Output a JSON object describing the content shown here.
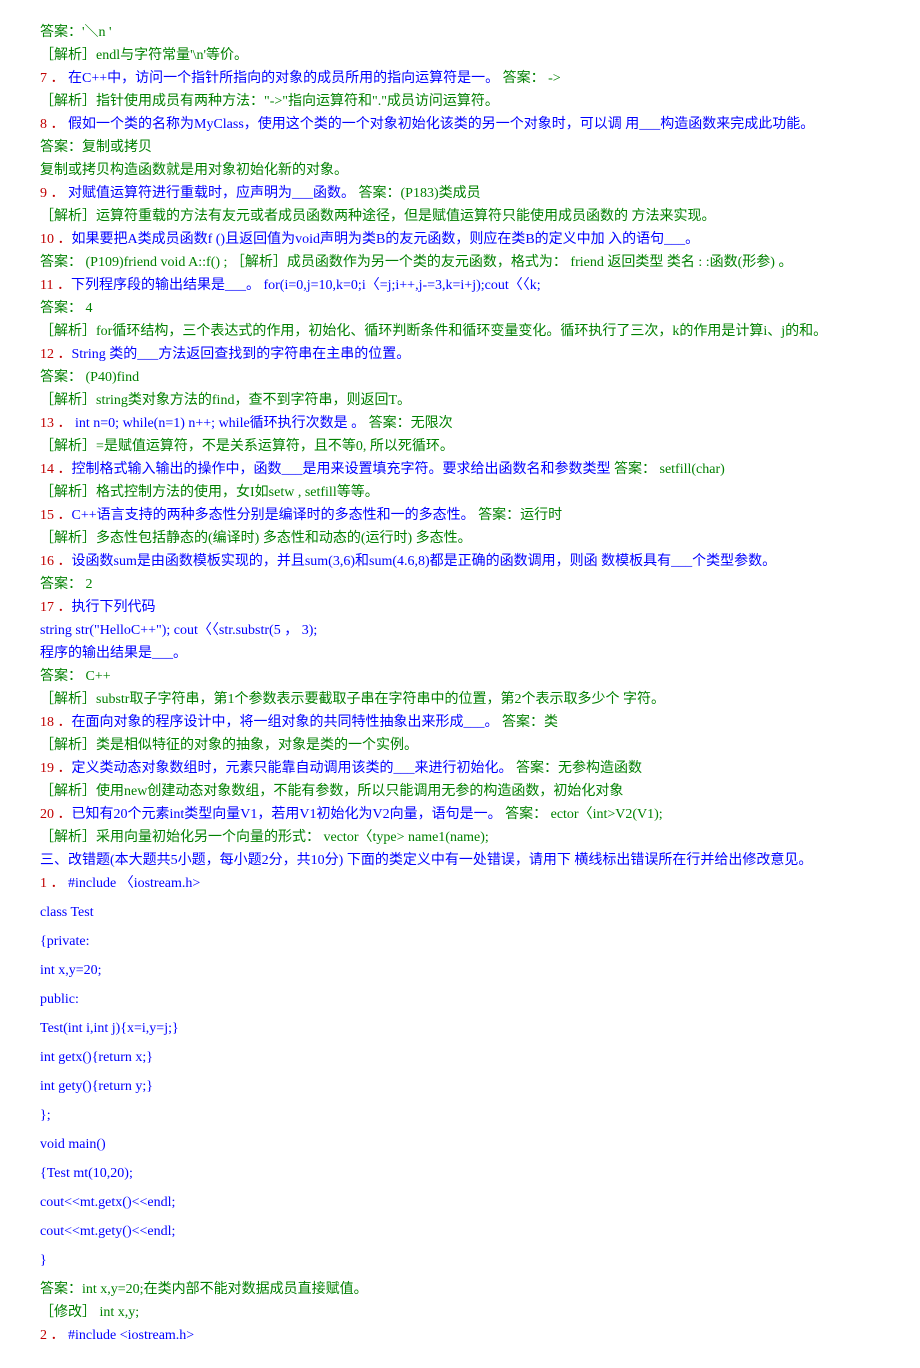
{
  "lines": [
    {
      "cls": "green",
      "t": "答案：'＼n '"
    },
    {
      "cls": "green",
      "t": "［解析］endl与字符常量'\\n'等价。"
    },
    {
      "parts": [
        {
          "cls": "red",
          "t": "7 ．"
        },
        {
          "cls": "blue",
          "t": "  在C++中，访问一个指针所指向的对象的成员所用的指向运算符是一。"
        },
        {
          "cls": "green",
          "t": "  答案： ->"
        }
      ]
    },
    {
      "cls": "green",
      "t": "［解析］指针使用成员有两种方法：\"->\"指向运算符和\".\"成员访问运算符。"
    },
    {
      "parts": [
        {
          "cls": "red",
          "t": "8 ．"
        },
        {
          "cls": "blue",
          "t": "  假如一个类的名称为MyClass，使用这个类的一个对象初始化该类的另一个对象时，可以调 用___构造函数来完成此功能。"
        }
      ]
    },
    {
      "cls": "green",
      "t": "答案：复制或拷贝"
    },
    {
      "cls": "green",
      "t": "复制或拷贝构造函数就是用对象初始化新的对象。"
    },
    {
      "parts": [
        {
          "cls": "red",
          "t": "9 ．"
        },
        {
          "cls": "blue",
          "t": "  对赋值运算符进行重载时，应声明为___函数。"
        },
        {
          "cls": "green",
          "t": " 答案：(P183)类成员"
        }
      ]
    },
    {
      "cls": "green",
      "t": "［解析］运算符重载的方法有友元或者成员函数两种途径，但是赋值运算符只能使用成员函数的 方法来实现。"
    },
    {
      "parts": [
        {
          "cls": "red",
          "t": "10 ．"
        },
        {
          "cls": "blue",
          "t": "如果要把A类成员函数f ()且返回值为void声明为类B的友元函数，则应在类B的定义中加 入的语句___。"
        }
      ]
    },
    {
      "cls": "green",
      "t": "答案： (P109)friend void A::f() ; ［解析］成员函数作为另一个类的友元函数，格式为： friend 返回类型  类名 : :函数(形参) 。"
    },
    {
      "parts": [
        {
          "cls": "red",
          "t": "11 ．"
        },
        {
          "cls": "blue",
          "t": "下列程序段的输出结果是___。  for(i=0,j=10,k=0;i〈=j;i++,j-=3,k=i+j);cout〈〈k;"
        }
      ]
    },
    {
      "cls": "green",
      "t": "答案： 4"
    },
    {
      "cls": "green",
      "t": "［解析］for循环结构，三个表达式的作用，初始化、循环判断条件和循环变量变化。循环执行了三次，k的作用是计算i、j的和。"
    },
    {
      "parts": [
        {
          "cls": "red",
          "t": "12 ．"
        },
        {
          "cls": "blue",
          "t": "String 类的___方法返回查找到的字符串在主串的位置。"
        }
      ]
    },
    {
      "cls": "green",
      "t": "答案： (P40)find"
    },
    {
      "cls": "green",
      "t": "［解析］string类对象方法的find，查不到字符串，则返回T。"
    },
    {
      "parts": [
        {
          "cls": "red",
          "t": "13 ．"
        },
        {
          "cls": "blue",
          "t": "  int n=0; while(n=1) n++; while循环执行次数是  。"
        },
        {
          "cls": "green",
          "t": " 答案：无限次"
        }
      ]
    },
    {
      "cls": "green",
      "t": "［解析］=是赋值运算符，不是关系运算符，且不等0, 所以死循环。"
    },
    {
      "parts": [
        {
          "cls": "red",
          "t": "14 ．"
        },
        {
          "cls": "blue",
          "t": "控制格式输入输出的操作中，函数___是用来设置填充字符。要求给出函数名和参数类型"
        },
        {
          "cls": "green",
          "t": " 答案： setfill(char)"
        }
      ]
    },
    {
      "cls": "green",
      "t": "［解析］格式控制方法的使用，女I如setw , setfill等等。"
    },
    {
      "parts": [
        {
          "cls": "red",
          "t": "15 ．"
        },
        {
          "cls": "blue",
          "t": "C++语言支持的两种多态性分别是编译时的多态性和一的多态性。"
        },
        {
          "cls": "green",
          "t": "  答案：运行时"
        }
      ]
    },
    {
      "cls": "green",
      "t": "［解析］多态性包括静态的(编译时) 多态性和动态的(运行时) 多态性。"
    },
    {
      "parts": [
        {
          "cls": "red",
          "t": "16 ．"
        },
        {
          "cls": "blue",
          "t": "设函数sum是由函数模板实现的，并且sum(3,6)和sum(4.6,8)都是正确的函数调用，则函 数模板具有___个类型参数。"
        }
      ]
    },
    {
      "cls": "green",
      "t": "答案： 2"
    },
    {
      "parts": [
        {
          "cls": "red",
          "t": "17 ．"
        },
        {
          "cls": "blue",
          "t": "执行下列代码"
        }
      ]
    },
    {
      "cls": "blue code",
      "t": "string str(\"HelloC++\"); cout〈〈str.substr(5 ， 3);"
    },
    {
      "cls": "blue",
      "t": "程序的输出结果是___。"
    },
    {
      "cls": "green",
      "t": "答案： C++"
    },
    {
      "cls": "green",
      "t": "［解析］substr取子字符串，第1个参数表示要截取子串在字符串中的位置，第2个表示取多少个 字符。"
    },
    {
      "parts": [
        {
          "cls": "red",
          "t": "18 ．"
        },
        {
          "cls": "blue",
          "t": "在面向对象的程序设计中，将一组对象的共同特性抽象出来形成___。"
        },
        {
          "cls": "green",
          "t": "  答案：类"
        }
      ]
    },
    {
      "cls": "green",
      "t": "［解析］类是相似特征的对象的抽象，对象是类的一个实例。"
    },
    {
      "parts": [
        {
          "cls": "red",
          "t": "19 ．"
        },
        {
          "cls": "blue",
          "t": "定义类动态对象数组时，元素只能靠自动调用该类的___来进行初始化。"
        },
        {
          "cls": "green",
          "t": " 答案：无参构造函数"
        }
      ]
    },
    {
      "cls": "green",
      "t": "［解析］使用new创建动态对象数组，不能有参数，所以只能调用无参的构造函数，初始化对象"
    },
    {
      "parts": [
        {
          "cls": "red",
          "t": "20 ．"
        },
        {
          "cls": "blue",
          "t": "已知有20个元素int类型向量V1，若用V1初始化为V2向量，语句是一。"
        },
        {
          "cls": "green",
          "t": "  答案： ector〈int>V2(V1);"
        }
      ]
    },
    {
      "cls": "green",
      "t": "［解析］采用向量初始化另一个向量的形式： vector〈type> name1(name);"
    },
    {
      "cls": "blue",
      "t": "三、改错题(本大题共5小题，每小题2分，共10分) 下面的类定义中有一处错误，请用下 横线标出错误所在行并给出修改意见。"
    },
    {
      "parts": [
        {
          "cls": "red",
          "t": "1 ．"
        },
        {
          "cls": "blue code",
          "t": "  #include 〈iostream.h>"
        }
      ]
    },
    {
      "cls": "blue code",
      "t": "class Test",
      "sp": true
    },
    {
      "cls": "blue code",
      "t": "{private:",
      "sp": true
    },
    {
      "cls": "blue code",
      "t": "int x,y=20;",
      "sp": true
    },
    {
      "cls": "blue code",
      "t": "public:",
      "sp": true
    },
    {
      "cls": "blue code",
      "t": "Test(int i,int j){x=i,y=j;}",
      "sp": true
    },
    {
      "cls": "blue code",
      "t": "int getx(){return x;}",
      "sp": true
    },
    {
      "cls": "blue code",
      "t": "int gety(){return y;}",
      "sp": true
    },
    {
      "cls": "blue code",
      "t": "};",
      "sp": true
    },
    {
      "cls": "blue code",
      "t": "void main()",
      "sp": true
    },
    {
      "cls": "blue code",
      "t": "{Test mt(10,20);",
      "sp": true
    },
    {
      "cls": "blue code",
      "t": "cout<<mt.getx()<<endl;",
      "sp": true
    },
    {
      "cls": "blue code",
      "t": "cout<<mt.gety()<<endl;",
      "sp": true
    },
    {
      "cls": "blue code",
      "t": "}",
      "sp": true
    },
    {
      "cls": "green",
      "t": "答案：int x,y=20;在类内部不能对数据成员直接赋值。"
    },
    {
      "cls": "green",
      "t": "［修改］ int x,y;"
    },
    {
      "parts": [
        {
          "cls": "red",
          "t": "2 ．"
        },
        {
          "cls": "blue code",
          "t": "  #include <iostream.h>"
        }
      ]
    }
  ]
}
